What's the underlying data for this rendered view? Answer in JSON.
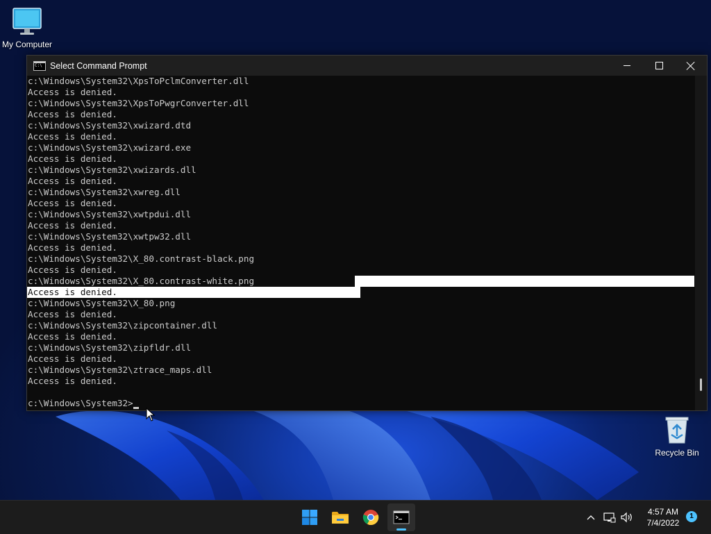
{
  "desktop": {
    "icons": [
      {
        "label": "My Computer",
        "icon": "monitor-icon"
      },
      {
        "label": "Recycle Bin",
        "icon": "recycle-bin-icon"
      }
    ]
  },
  "window": {
    "title": "Select Command Prompt",
    "icon": "command-prompt-icon",
    "controls": [
      "minimize",
      "maximize",
      "close"
    ]
  },
  "console": {
    "lines": [
      "c:\\Windows\\System32\\XpsToPclmConverter.dll",
      "Access is denied.",
      "c:\\Windows\\System32\\XpsToPwgrConverter.dll",
      "Access is denied.",
      "c:\\Windows\\System32\\xwizard.dtd",
      "Access is denied.",
      "c:\\Windows\\System32\\xwizard.exe",
      "Access is denied.",
      "c:\\Windows\\System32\\xwizards.dll",
      "Access is denied.",
      "c:\\Windows\\System32\\xwreg.dll",
      "Access is denied.",
      "c:\\Windows\\System32\\xwtpdui.dll",
      "Access is denied.",
      "c:\\Windows\\System32\\xwtpw32.dll",
      "Access is denied.",
      "c:\\Windows\\System32\\X_80.contrast-black.png",
      "Access is denied.",
      "c:\\Windows\\System32\\X_80.contrast-white.png",
      "Access is denied.",
      "c:\\Windows\\System32\\X_80.png",
      "Access is denied.",
      "c:\\Windows\\System32\\zipcontainer.dll",
      "Access is denied.",
      "c:\\Windows\\System32\\zipfldr.dll",
      "Access is denied.",
      "c:\\Windows\\System32\\ztrace_maps.dll",
      "Access is denied.",
      ""
    ],
    "prompt": "c:\\Windows\\System32>"
  },
  "taskbar": {
    "apps": [
      {
        "name": "start",
        "icon": "windows-start-icon"
      },
      {
        "name": "file-explorer",
        "icon": "folder-icon"
      },
      {
        "name": "chrome",
        "icon": "chrome-icon"
      },
      {
        "name": "command-prompt",
        "icon": "terminal-icon",
        "active": true
      }
    ],
    "tray": {
      "time": "4:57 AM",
      "date": "7/4/2022",
      "notifications": "1"
    }
  },
  "colors": {
    "console_bg": "#0c0c0c",
    "console_text": "#cccccc",
    "accent": "#4cc2ff"
  }
}
